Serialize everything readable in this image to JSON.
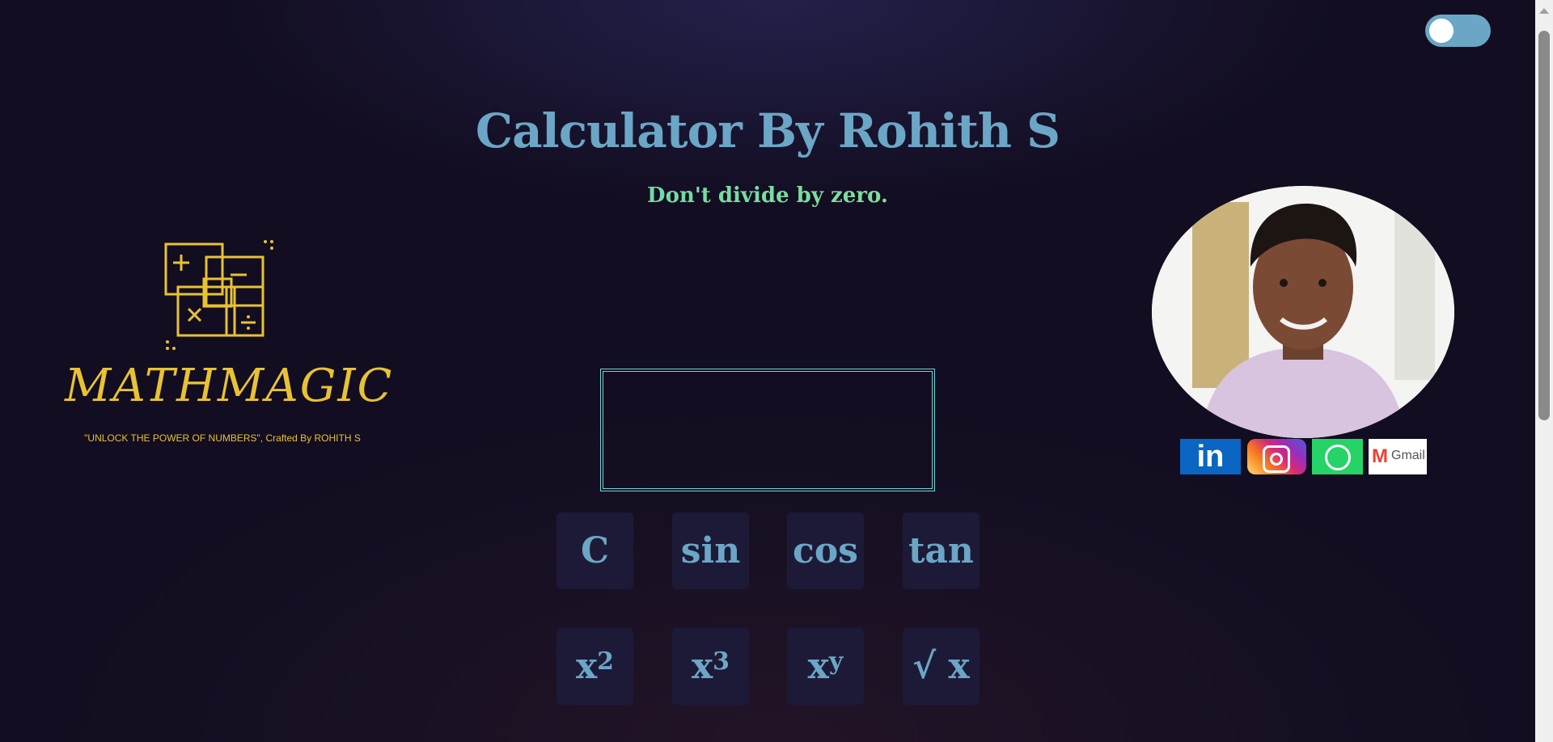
{
  "header": {
    "title": "Calculator By Rohith S",
    "subtitle": "Don't divide by zero."
  },
  "theme_toggle": {
    "state": "off",
    "color": "#6ba6c6"
  },
  "logo": {
    "word": "MATHMAGIC",
    "tagline": "\"UNLOCK THE POWER OF NUMBERS\", Crafted By ROHITH S",
    "color": "#e8c233"
  },
  "display": {
    "value": ""
  },
  "buttons": {
    "row1": [
      "C",
      "sin",
      "cos",
      "tan"
    ],
    "row2": {
      "x2_base": "x",
      "x2_exp": "2",
      "x3_base": "x",
      "x3_exp": "3",
      "xy_base": "x",
      "xy_exp": "y",
      "sqrt": "√ x"
    }
  },
  "social": {
    "linkedin": "in",
    "gmail": "Gmail"
  },
  "colors": {
    "accent": "#6ba6c6",
    "button_bg": "#1d1a38",
    "display_border": "#6fd6d8",
    "background": "#120d20"
  }
}
